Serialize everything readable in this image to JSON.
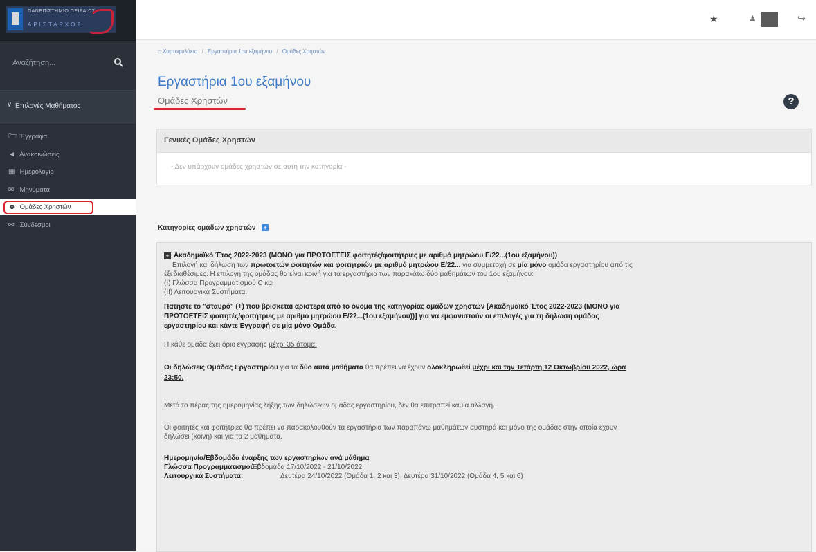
{
  "sidebar": {
    "logo": {
      "title": "ΠΑΝΕΠΙΣΤΗΜΙΟ ΠΕΙΡΑΙΩΣ",
      "subtitle": "ΑΡΙΣΤΑΡΧΟΣ"
    },
    "search_placeholder": "Αναζήτηση...",
    "section": "Επιλογές Μαθήματος",
    "items": [
      {
        "label": "Έγγραφα",
        "icon": "folder-icon"
      },
      {
        "label": "Ανακοινώσεις",
        "icon": "bullhorn-icon"
      },
      {
        "label": "Ημερολόγιο",
        "icon": "calendar-icon"
      },
      {
        "label": "Μηνύματα",
        "icon": "envelope-icon"
      },
      {
        "label": "Ομάδες Χρηστών",
        "icon": "users-icon",
        "active": true
      },
      {
        "label": "Σύνδεσμοι",
        "icon": "link-icon"
      }
    ]
  },
  "main": {
    "breadcrumb": [
      "Χαρτοφυλάκιο",
      "Εργαστήρια 1ου εξαμήνου",
      "Ομάδες Χρηστών"
    ],
    "title": "Εργαστήρια 1ου εξαμήνου",
    "subtitle": "Ομάδες Χρηστών",
    "general_panel": {
      "heading": "Γενικές Ομάδες Χρηστών",
      "empty_text": "- Δεν υπάρχουν ομάδες χρηστών σε αυτή την κατηγορία -"
    },
    "categories_heading": "Κατηγορίες ομάδων χρηστών",
    "category": {
      "title": "Ακαδημαϊκό Έτος 2022-2023 (ΜΟΝΟ για ΠΡΩΤΟΕΤΕΙΣ φοιτητές/φοιτήτριες με αριθμό μητρώου Ε/22...(1ου εξαμήνου))",
      "p1_a": "Επιλογή και δήλωση των ",
      "p1_b": "πρωτοετών φοιτητών και φοιτητριών με αριθμό μητρώου Ε/22...",
      "p1_c": " για συμμετοχή σε ",
      "p1_d": "μία μόνο",
      "p1_e": " ομάδα εργαστηρίου από τις",
      "p1_f": "έξι διαθέσιμες. Η επιλογή της ομάδας θα είναι ",
      "p1_g": "κοινή",
      "p1_h": " για τα εργαστήρια των ",
      "p1_i": "παρακάτω δύο μαθημάτων του 1ου εξαμήνου",
      "p1_j": ":",
      "line_i": "(Ι) Γλώσσα Προγραμματισμού C και",
      "line_ii": "(ΙΙ) Λειτουργικά Συστήματα.",
      "p2_a": "Πατήστε το \"σταυρό\" (+) που βρίσκεται αριστερά από το όνομα της κατηγορίας ομάδων χρηστών [Ακαδημαϊκό Έτος 2022-2023 (ΜΟΝΟ για",
      "p2_b": "ΠΡΩΤΟΕΤΕΙΣ φοιτητές/φοιτήτριες με αριθμό μητρώου Ε/22...(1ου εξαμήνου))] για να εμφανιστούν οι επιλογές για τη δήλωση ομάδας",
      "p2_c": "εργαστηρίου και ",
      "p2_d": "κάντε Εγγραφή σε μία μόνο Ομάδα.",
      "p3_a": "Η κάθε ομάδα έχει όριο εγγραφής ",
      "p3_b": "μέχρι 35 άτομα.",
      "p4_a": "Οι δηλώσεις Ομάδας Εργαστηρίου",
      "p4_b": " για τα ",
      "p4_c": "δύο αυτά μαθήματα",
      "p4_d": " θα πρέπει να έχουν ",
      "p4_e": "ολοκληρωθεί ",
      "p4_f": "μέχρι και την Τετάρτη 12 Οκτωβρίου 2022, ώρα",
      "p4_g": "23:50.",
      "p5": "Μετά το πέρας της ημερομηνίας λήξης των δηλώσεων ομάδας εργαστηρίου, δεν θα επιτραπεί καμία αλλαγή.",
      "p6_a": "Οι φοιτητές και φοιτήτριες θα πρέπει να παρακολουθούν τα εργαστήρια των παραπάνω μαθημάτων αυστηρά και μόνο της ομάδας στην οποία έχουν",
      "p6_b": "δηλώσει (κοινή) και για τα 2 μαθήματα.",
      "schedule_title": "Ημερομηνία/Εβδομάδα έναρξης των εργαστηρίων ανά μάθημα",
      "schedule": [
        {
          "course": "Γλώσσα Προγραμματισμού C:",
          "when": "Εβδομάδα 17/10/2022 - 21/10/2022"
        },
        {
          "course": "Λειτουργικά Συστήματα:",
          "when": "Δευτέρα 24/10/2022 (Ομάδα 1, 2 και 3), Δευτέρα 31/10/2022 (Ομάδα 4, 5 και 6)"
        }
      ]
    }
  },
  "colors": {
    "sidebar_bg": "#2c3139",
    "accent_blue": "#3d7bc8",
    "highlight_red": "#d9232e"
  },
  "icons": {
    "home": "home-icon",
    "help": "question-circle-icon",
    "topbar": [
      "star-icon",
      "user-icon",
      "exit-icon"
    ]
  }
}
